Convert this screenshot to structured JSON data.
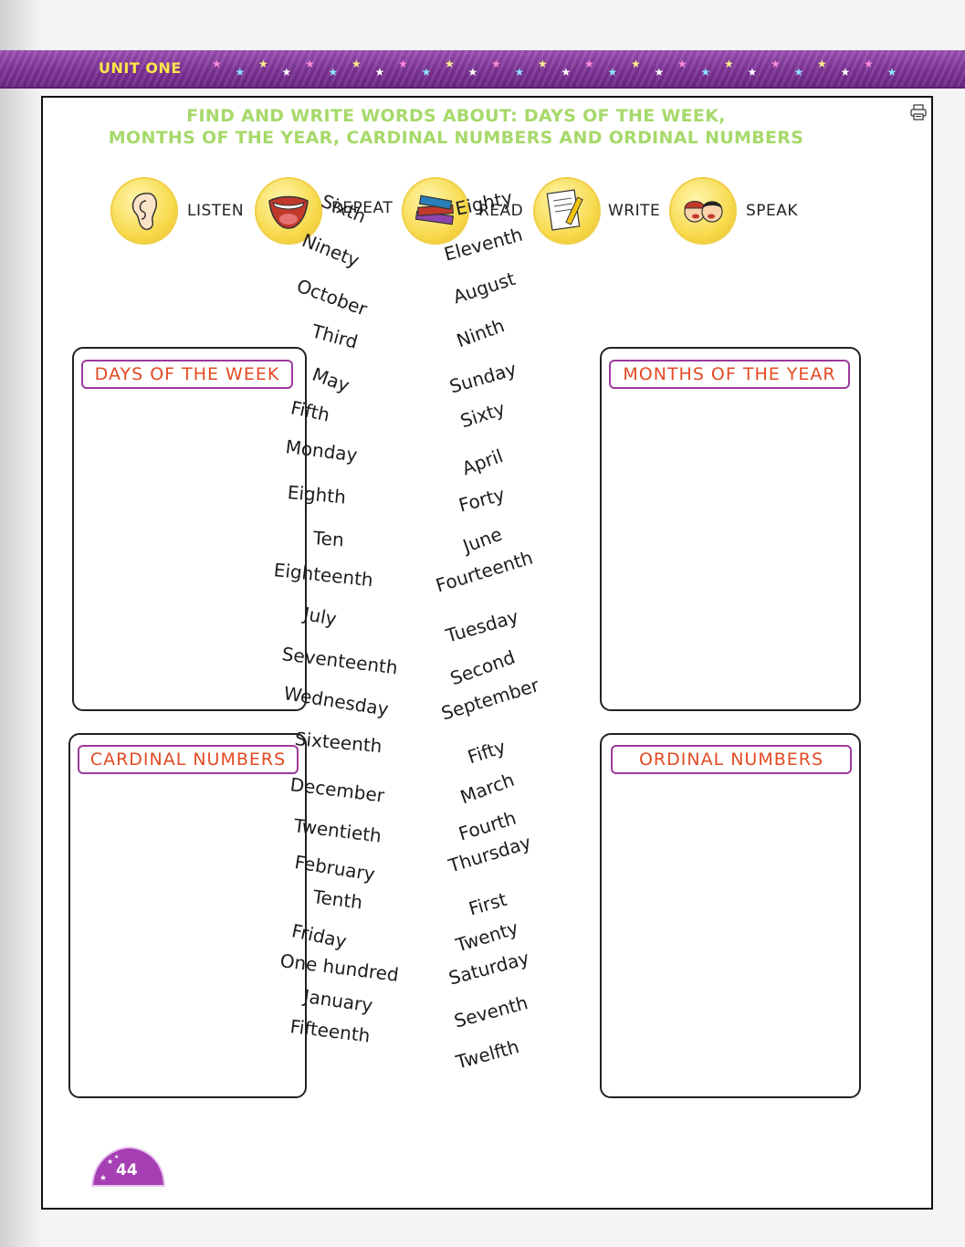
{
  "banner": {
    "title": "UNIT ONE"
  },
  "heading": {
    "line1": "FIND AND WRITE WORDS ABOUT: DAYS OF THE WEEK,",
    "line2": "MONTHS OF THE YEAR, CARDINAL NUMBERS AND ORDINAL NUMBERS"
  },
  "skills": [
    {
      "label": "LISTEN",
      "icon": "ear-icon"
    },
    {
      "label": "REPEAT",
      "icon": "mouth-icon"
    },
    {
      "label": "READ",
      "icon": "books-icon"
    },
    {
      "label": "WRITE",
      "icon": "paper-pencil-icon"
    },
    {
      "label": "SPEAK",
      "icon": "kids-talking-icon"
    }
  ],
  "boxes": {
    "days": "DAYS OF THE WEEK",
    "months": "MONTHS OF THE YEAR",
    "cardinal": "CARDINAL NUMBERS",
    "ordinal": "ORDINAL NUMBERS"
  },
  "words_left": [
    "Sixth",
    "Ninety",
    "October",
    "Third",
    "May",
    "Fifth",
    "Monday",
    "Eighth",
    "Ten",
    "Eighteenth",
    "July",
    "Seventeenth",
    "Wednesday",
    "Sixteenth",
    "December",
    "Twentieth",
    "February",
    "Tenth",
    "Friday",
    "One hundred",
    "January",
    "Fifteenth"
  ],
  "words_right": [
    "Eighty",
    "Eleventh",
    "August",
    "Ninth",
    "Sunday",
    "Sixty",
    "April",
    "Forty",
    "June",
    "Fourteenth",
    "Tuesday",
    "Second",
    "September",
    "Fifty",
    "March",
    "Fourth",
    "Thursday",
    "First",
    "Twenty",
    "Saturday",
    "Seventh",
    "Twelfth"
  ],
  "page_number": "44",
  "colors": {
    "banner": "#7d3396",
    "banner_title": "#ffe64a",
    "heading": "#a6d96a",
    "box_title_text": "#e34a22",
    "box_title_border": "#9c3a9c"
  }
}
